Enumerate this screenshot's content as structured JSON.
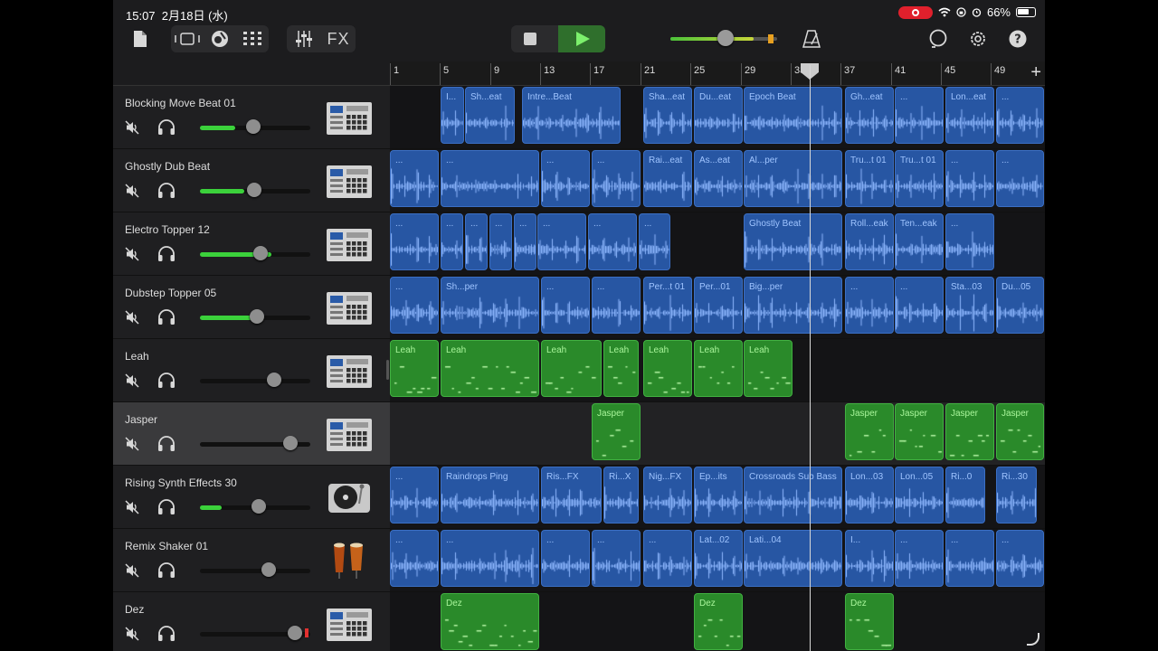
{
  "status": {
    "time": "15:07",
    "date": "2月18日 (水)",
    "battery": "66%"
  },
  "toolbar": {
    "fx_label": "FX"
  },
  "ruler": {
    "bars": [
      "1",
      "5",
      "9",
      "13",
      "17",
      "21",
      "25",
      "29",
      "33",
      "37",
      "41",
      "45",
      "49"
    ],
    "add_label": "+"
  },
  "tracks": [
    {
      "name": "Blocking Move Beat 01",
      "instrument": "drum-machine-icon",
      "volume": 0.48,
      "level": 0.32,
      "regions": [
        [
          "I...",
          0.0776,
          0.0373,
          "a"
        ],
        [
          "Sh...eat",
          0.1146,
          0.0777,
          "a"
        ],
        [
          "Intre...Beat",
          0.2017,
          0.1522,
          "a"
        ],
        [
          "Sha...eat",
          0.3867,
          0.0762,
          "a"
        ],
        [
          "Du...eat",
          0.4637,
          0.0762,
          "a"
        ],
        [
          "Epoch Beat",
          0.5407,
          0.1522,
          "a"
        ],
        [
          "Gh...eat",
          0.6943,
          0.0762,
          "a"
        ],
        [
          "...",
          0.7713,
          0.0762,
          "a"
        ],
        [
          "Lon...eat",
          0.8483,
          0.0762,
          "a"
        ],
        [
          "...",
          0.9253,
          0.0747,
          "a"
        ]
      ]
    },
    {
      "name": "Ghostly Dub Beat",
      "instrument": "drum-machine-icon",
      "volume": 0.49,
      "level": 0.4,
      "regions": [
        [
          "...",
          0.0,
          0.0762,
          "a"
        ],
        [
          "...",
          0.0776,
          0.1522,
          "a"
        ],
        [
          "...",
          0.2307,
          0.0762,
          "a"
        ],
        [
          "...",
          0.3077,
          0.0762,
          "a"
        ],
        [
          "Rai...eat",
          0.3867,
          0.0762,
          "a"
        ],
        [
          "As...eat",
          0.4637,
          0.0762,
          "a"
        ],
        [
          "Al...per",
          0.5407,
          0.1522,
          "a"
        ],
        [
          "Tru...t 01",
          0.6943,
          0.0762,
          "a"
        ],
        [
          "Tru...t 01",
          0.7713,
          0.0762,
          "a"
        ],
        [
          "...",
          0.8483,
          0.0762,
          "a"
        ],
        [
          "...",
          0.9253,
          0.0747,
          "a"
        ]
      ]
    },
    {
      "name": "Electro Topper 12",
      "instrument": "drum-machine-icon",
      "volume": 0.55,
      "level": 0.65,
      "regions": [
        [
          "...",
          0.0,
          0.0762,
          "a"
        ],
        [
          "...",
          0.0776,
          0.0356,
          "a"
        ],
        [
          "...",
          0.1146,
          0.0356,
          "a"
        ],
        [
          "...",
          0.1516,
          0.0356,
          "a"
        ],
        [
          "...",
          0.1886,
          0.0356,
          "a"
        ],
        [
          "...",
          0.2256,
          0.0762,
          "a"
        ],
        [
          "...",
          0.3027,
          0.0762,
          "a"
        ],
        [
          "...",
          0.3797,
          0.0493,
          "a"
        ],
        [
          "Ghostly Beat",
          0.5407,
          0.1522,
          "a"
        ],
        [
          "Roll...eak",
          0.6943,
          0.0762,
          "a"
        ],
        [
          "Ten...eak",
          0.7713,
          0.0762,
          "a"
        ],
        [
          "...",
          0.8483,
          0.0762,
          "a"
        ]
      ]
    },
    {
      "name": "Dubstep Topper 05",
      "instrument": "drum-machine-icon",
      "volume": 0.52,
      "level": 0.5,
      "regions": [
        [
          "...",
          0.0,
          0.0762,
          "a"
        ],
        [
          "Sh...per",
          0.0776,
          0.1522,
          "a"
        ],
        [
          "...",
          0.2307,
          0.0762,
          "a"
        ],
        [
          "...",
          0.3077,
          0.0762,
          "a"
        ],
        [
          "Per...t 01",
          0.3867,
          0.0762,
          "a"
        ],
        [
          "Per...01",
          0.4637,
          0.0762,
          "a"
        ],
        [
          "Big...per",
          0.5407,
          0.1522,
          "a"
        ],
        [
          "...",
          0.6943,
          0.0762,
          "a"
        ],
        [
          "...",
          0.7713,
          0.0762,
          "a"
        ],
        [
          "Sta...03",
          0.8483,
          0.0762,
          "a"
        ],
        [
          "Du...05",
          0.9253,
          0.0747,
          "a"
        ]
      ]
    },
    {
      "name": "Leah",
      "instrument": "drum-machine-icon",
      "volume": 0.67,
      "level": 0,
      "regions": [
        [
          "Leah",
          0.0,
          0.0762,
          "m"
        ],
        [
          "Leah",
          0.0776,
          0.1522,
          "m"
        ],
        [
          "Leah",
          0.2307,
          0.0941,
          "m"
        ],
        [
          "Leah",
          0.3262,
          0.0559,
          "m"
        ],
        [
          "Leah",
          0.3867,
          0.0762,
          "m"
        ],
        [
          "Leah",
          0.4637,
          0.0762,
          "m"
        ],
        [
          "Leah",
          0.5407,
          0.0762,
          "m"
        ]
      ]
    },
    {
      "name": "Jasper",
      "instrument": "drum-machine-icon",
      "volume": 0.82,
      "level": 0,
      "selected": true,
      "regions": [
        [
          "Jasper",
          0.3077,
          0.0762,
          "m"
        ],
        [
          "Jasper",
          0.6943,
          0.0762,
          "m"
        ],
        [
          "Jasper",
          0.7713,
          0.0762,
          "m"
        ],
        [
          "Jasper",
          0.8483,
          0.0762,
          "m"
        ],
        [
          "Jasper",
          0.9253,
          0.0747,
          "m"
        ]
      ]
    },
    {
      "name": "Rising Synth Effects 30",
      "instrument": "turntable-icon",
      "volume": 0.53,
      "level": 0.2,
      "regions": [
        [
          "...",
          0.0,
          0.0762,
          "a"
        ],
        [
          "Raindrops Ping",
          0.0776,
          0.1522,
          "a"
        ],
        [
          "Ris...FX",
          0.2307,
          0.0941,
          "a"
        ],
        [
          "Ri...X",
          0.3262,
          0.0559,
          "a"
        ],
        [
          "Nig...FX",
          0.3867,
          0.0762,
          "a"
        ],
        [
          "Ep...its",
          0.4637,
          0.0762,
          "a"
        ],
        [
          "Crossroads Sub Bass",
          0.5407,
          0.1522,
          "a"
        ],
        [
          "Lon...03",
          0.6943,
          0.0762,
          "a"
        ],
        [
          "Lon...05",
          0.7713,
          0.0762,
          "a"
        ],
        [
          "Ri...0",
          0.8483,
          0.0627,
          "a"
        ],
        [
          "Ri...30",
          0.9253,
          0.0642,
          "a"
        ]
      ]
    },
    {
      "name": "Remix Shaker 01",
      "instrument": "conga-icon",
      "volume": 0.62,
      "level": 0,
      "regions": [
        [
          "...",
          0.0,
          0.0762,
          "a"
        ],
        [
          "...",
          0.0776,
          0.1522,
          "a"
        ],
        [
          "...",
          0.2307,
          0.0762,
          "a"
        ],
        [
          "...",
          0.3077,
          0.0762,
          "a"
        ],
        [
          "...",
          0.3867,
          0.0762,
          "a"
        ],
        [
          "Lat...02",
          0.4637,
          0.0762,
          "a"
        ],
        [
          "Lati...04",
          0.5407,
          0.1522,
          "a"
        ],
        [
          "I...",
          0.6943,
          0.0762,
          "a"
        ],
        [
          "...",
          0.7713,
          0.0762,
          "a"
        ],
        [
          "...",
          0.8483,
          0.0762,
          "a"
        ],
        [
          "...",
          0.9253,
          0.0747,
          "a"
        ]
      ]
    },
    {
      "name": "Dez",
      "instrument": "drum-machine-icon",
      "volume": 0.86,
      "level": 0,
      "clip": true,
      "regions": [
        [
          "Dez",
          0.0776,
          0.1522,
          "m"
        ],
        [
          "Dez",
          0.4637,
          0.0762,
          "m"
        ],
        [
          "Dez",
          0.6943,
          0.0762,
          "m"
        ]
      ]
    }
  ],
  "playhead_bar": 33,
  "colors": {
    "audio_region": "#2756a3",
    "midi_region": "#2a8a2a",
    "accent_green": "#3bd13b",
    "play_green": "#7cf06c"
  }
}
